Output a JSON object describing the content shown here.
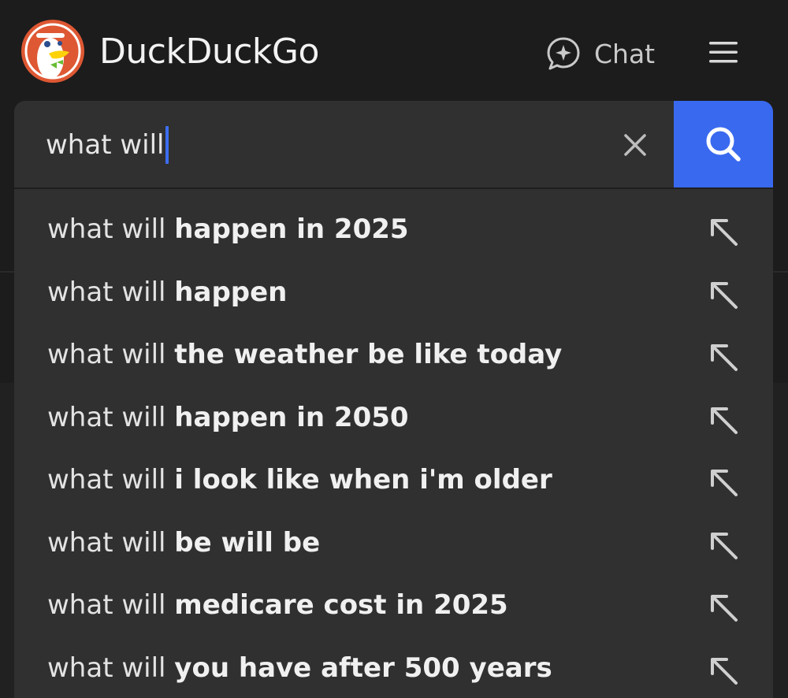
{
  "header": {
    "brand": "DuckDuckGo",
    "chat_label": "Chat",
    "logo_icon": "duckduckgo-logo",
    "chat_icon": "chat-sparkle-icon",
    "menu_icon": "hamburger-menu-icon"
  },
  "search": {
    "query": "what will",
    "clear_icon": "close-icon",
    "submit_icon": "search-icon",
    "accent_color": "#3969ef"
  },
  "suggestions": [
    {
      "prefix": "what will",
      "completion": "happen in 2025"
    },
    {
      "prefix": "what will",
      "completion": "happen"
    },
    {
      "prefix": "what will",
      "completion": "the weather be like today"
    },
    {
      "prefix": "what will",
      "completion": "happen in 2050"
    },
    {
      "prefix": "what will",
      "completion": "i look like when i'm older"
    },
    {
      "prefix": "what will",
      "completion": "be will be"
    },
    {
      "prefix": "what will",
      "completion": "medicare cost in 2025"
    },
    {
      "prefix": "what will",
      "completion": "you have after 500 years"
    }
  ]
}
